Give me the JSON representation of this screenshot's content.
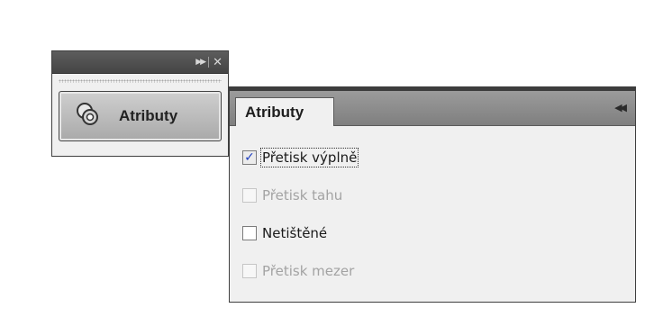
{
  "mini_panel": {
    "collapse_icon": "double-right-arrows-icon",
    "close_icon": "close-icon",
    "button": {
      "icon": "attributes-icon",
      "label": "Atributy"
    }
  },
  "attributes_panel": {
    "tab_label": "Atributy",
    "expand_icon": "double-left-arrows-icon",
    "options": [
      {
        "label": "Přetisk výplně",
        "checked": true,
        "enabled": true,
        "focused": true
      },
      {
        "label": "Přetisk tahu",
        "checked": false,
        "enabled": false,
        "focused": false
      },
      {
        "label": "Netištěné",
        "checked": false,
        "enabled": true,
        "focused": false
      },
      {
        "label": "Přetisk mezer",
        "checked": false,
        "enabled": false,
        "focused": false
      }
    ]
  },
  "colors": {
    "titlebar": "#4f4f4f",
    "panel_bg": "#f0f0f0",
    "tabbar": "#8d8d8d",
    "checkmark": "#1f3fbf"
  }
}
